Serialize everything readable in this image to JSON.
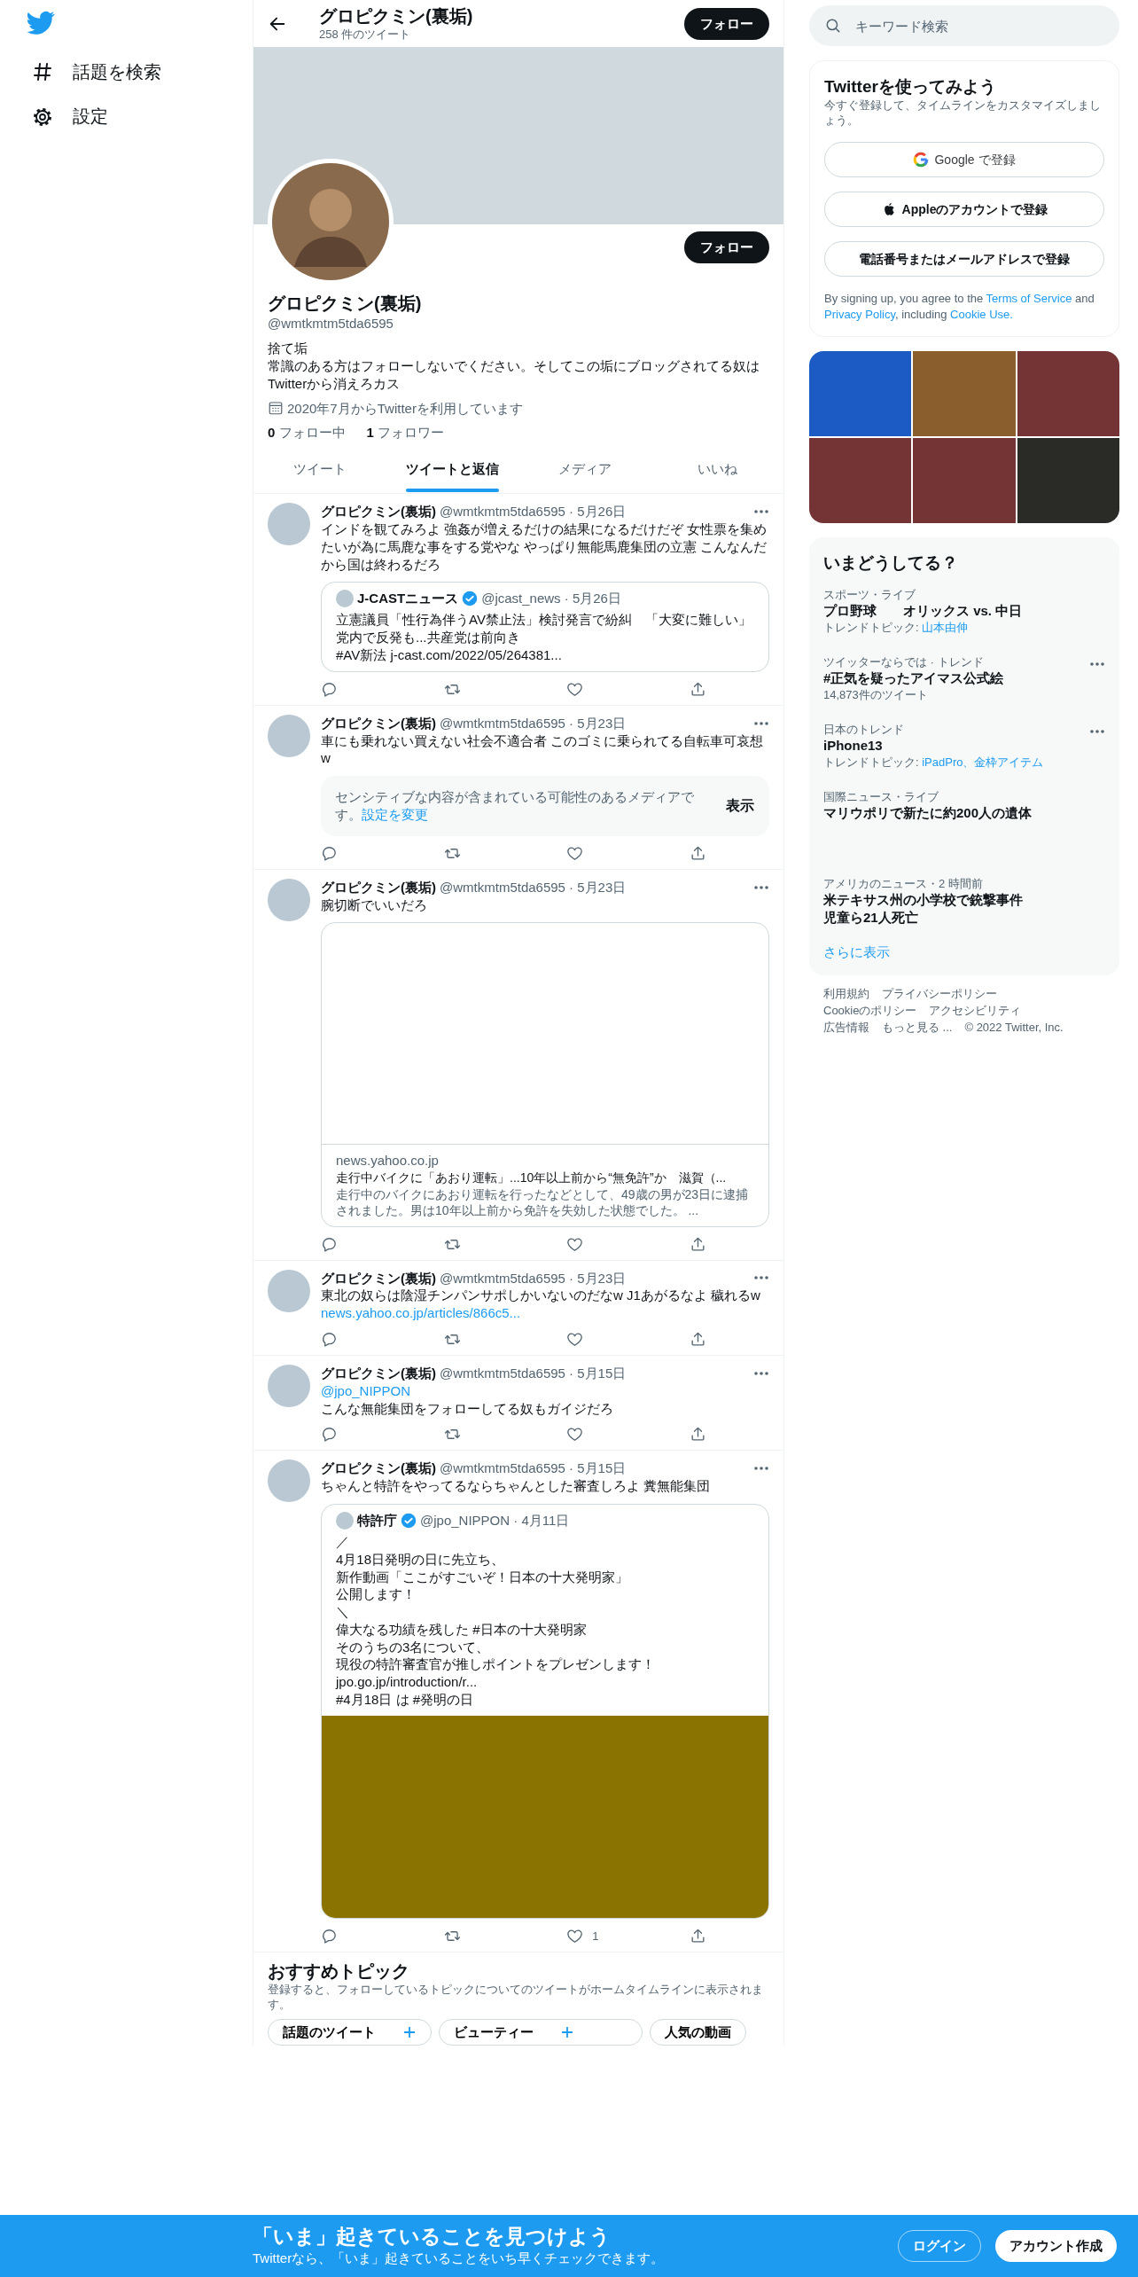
{
  "sidebar": {
    "items": [
      {
        "label": "話題を検索",
        "kind": "explore"
      },
      {
        "label": "設定",
        "kind": "settings"
      }
    ]
  },
  "header": {
    "name": "グロピクミン(裏垢)",
    "tweet_count": "258 件のツイート",
    "follow_button": "フォロー"
  },
  "profile": {
    "follow_button": "フォロー",
    "name": "グロピクミン(裏垢)",
    "handle": "@wmtkmtm5tda6595",
    "bio": [
      "捨て垢",
      "常識のある方はフォローしないでください。そしてこの垢にブロッグされてる奴はTwitterから消えろカス"
    ],
    "joined": "2020年7月からTwitterを利用しています",
    "following": {
      "count": "0",
      "label": "フォロー中"
    },
    "followers": {
      "count": "1",
      "label": "フォロワー"
    }
  },
  "tabs": [
    {
      "label": "ツイート",
      "selected": false
    },
    {
      "label": "ツイートと返信",
      "selected": true
    },
    {
      "label": "メディア",
      "selected": false
    },
    {
      "label": "いいね",
      "selected": false
    }
  ],
  "tweets": [
    {
      "name": "グロピクミン(裏垢)",
      "meta": "@wmtkmtm5tda6595 · 5月26日",
      "text": "インドを観てみろよ 強姦が増えるだけの結果になるだけだぞ 女性票を集めたいが為に馬鹿な事をする党やな やっぱり無能馬鹿集団の立憲 こんなんだから国は終わるだろ",
      "attachment": {
        "kind": "quote",
        "name": "J-CASTニュース",
        "verified": true,
        "meta": "@jcast_news · 5月26日",
        "lines": [
          "立憲議員「性行為伴うAV禁止法」検討発言で紛糾　「大変に難しい」党内で反発も...共産党は前向き",
          "#AV新法  j-cast.com/2022/05/264381..."
        ]
      }
    },
    {
      "name": "グロピクミン(裏垢)",
      "meta": "@wmtkmtm5tda6595 · 5月23日",
      "text": "車にも乗れない買えない社会不適合者 このゴミに乗られてる自転車可哀想w",
      "attachment": {
        "kind": "sensitive",
        "text": "センシティブな内容が含まれている可能性のあるメディアです。",
        "link": "設定を変更",
        "button": "表示"
      }
    },
    {
      "name": "グロピクミン(裏垢)",
      "meta": "@wmtkmtm5tda6595 · 5月23日",
      "text": "腕切断でいいだろ",
      "attachment": {
        "kind": "card",
        "domain": "news.yahoo.co.jp",
        "title": "走行中バイクに「あおり運転」...10年以上前から“無免許”か　滋賀（...",
        "description": "走行中のバイクにあおり運転を行ったなどとして、49歳の男が23日に逮捕されました。男は10年以上前から免許を失効した状態でした。 ..."
      }
    },
    {
      "name": "グロピクミン(裏垢)",
      "meta": "@wmtkmtm5tda6595 · 5月23日",
      "text": "東北の奴らは陰湿チンパンサポしかいないのだなw J1あがるなよ 穢れるw",
      "link": "news.yahoo.co.jp/articles/866c5..."
    },
    {
      "name": "グロピクミン(裏垢)",
      "meta": "@wmtkmtm5tda6595 · 5月15日",
      "mention": "@jpo_NIPPON",
      "text": "こんな無能集団をフォローしてる奴もガイジだろ"
    },
    {
      "name": "グロピクミン(裏垢)",
      "meta": "@wmtkmtm5tda6595 · 5月15日",
      "text": "ちゃんと特許をやってるならちゃんとした審査しろよ 糞無能集団",
      "like_count": "1",
      "attachment": {
        "kind": "quote",
        "name": "特許庁",
        "verified": true,
        "meta": "@jpo_NIPPON · 4月11日",
        "lines": [
          "／",
          "4月18日発明の日に先立ち、",
          "新作動画「ここがすごいぞ！日本の十大発明家」",
          "公開します！",
          "＼",
          "偉大なる功績を残した #日本の十大発明家",
          "そのうちの3名について、",
          "現役の特許審査官が推しポイントをプレゼンします！",
          "jpo.go.jp/introduction/r...",
          "#4月18日 は #発明の日"
        ],
        "media": {
          "kind": "video"
        }
      }
    }
  ],
  "topics": {
    "title": "おすすめトピック",
    "description": "登録すると、フォローしているトピックについてのツイートがホームタイムラインに表示されます。",
    "chips": [
      {
        "label": "話題のツイート",
        "plus": true
      },
      {
        "label": "ビューティー",
        "plus": true
      },
      {
        "label": "人気の動画",
        "plus": false
      }
    ]
  },
  "search": {
    "placeholder": "キーワード検索"
  },
  "signup": {
    "title": "Twitterを使ってみよう",
    "subtitle": "今すぐ登録して、タイムラインをカスタマイズしましょう。",
    "buttons": [
      {
        "kind": "google",
        "label": "Google で登録"
      },
      {
        "kind": "apple",
        "label": "Appleのアカウントで登録"
      },
      {
        "kind": "phone",
        "label": "電話番号またはメールアドレスで登録"
      }
    ],
    "legal": [
      {
        "text": "By signing up, you agree to the ",
        "link": false
      },
      {
        "text": "Terms of Service",
        "link": true
      },
      {
        "text": " and ",
        "link": false
      },
      {
        "text": "Privacy Policy",
        "link": true
      },
      {
        "text": ", including ",
        "link": false
      },
      {
        "text": "Cookie Use.",
        "link": true
      }
    ]
  },
  "media_grid": [
    {
      "color": "#1c5bc4"
    },
    {
      "color": "#8b5e2e"
    },
    {
      "color": "#743436"
    },
    {
      "color": "#743436"
    },
    {
      "color": "#743436"
    },
    {
      "color": "#2a2b26"
    }
  ],
  "trends": {
    "title": "いまどうしてる？",
    "items": [
      {
        "context": "スポーツ・ライブ",
        "title": [
          "プロ野球　　オリックス vs. 中日"
        ],
        "topic_label": "トレンドトピック: ",
        "topic_links": "山本由伸",
        "menu": false
      },
      {
        "context": "ツイッターならでは · トレンド",
        "title": [
          "#正気を疑ったアイマス公式絵"
        ],
        "count": "14,873件のツイート",
        "menu": true
      },
      {
        "context": "日本のトレンド",
        "title": [
          "iPhone13"
        ],
        "topic_label": "トレンドトピック: ",
        "topic_links": "iPadPro、金枠アイテム",
        "menu": true
      },
      {
        "context": "国際ニュース・ライブ",
        "title": [
          "マリウポリで新たに約200人の遺体"
        ],
        "menu": false
      },
      {
        "context": "アメリカのニュース・2 時間前",
        "title": [
          "米テキサス州の小学校で銃撃事件",
          "児童ら21人死亡"
        ],
        "menu": false
      }
    ],
    "show_more": "さらに表示"
  },
  "footer": [
    "利用規約",
    "プライバシーポリシー",
    "Cookieのポリシー",
    "アクセシビリティ",
    "広告情報",
    "もっと見る ...",
    "© 2022 Twitter, Inc."
  ],
  "banner": {
    "title": "「いま」起きていることを見つけよう",
    "subtitle": "Twitterなら、「いま」起きていることをいち早くチェックできます。",
    "login": "ログイン",
    "signup": "アカウント作成"
  }
}
